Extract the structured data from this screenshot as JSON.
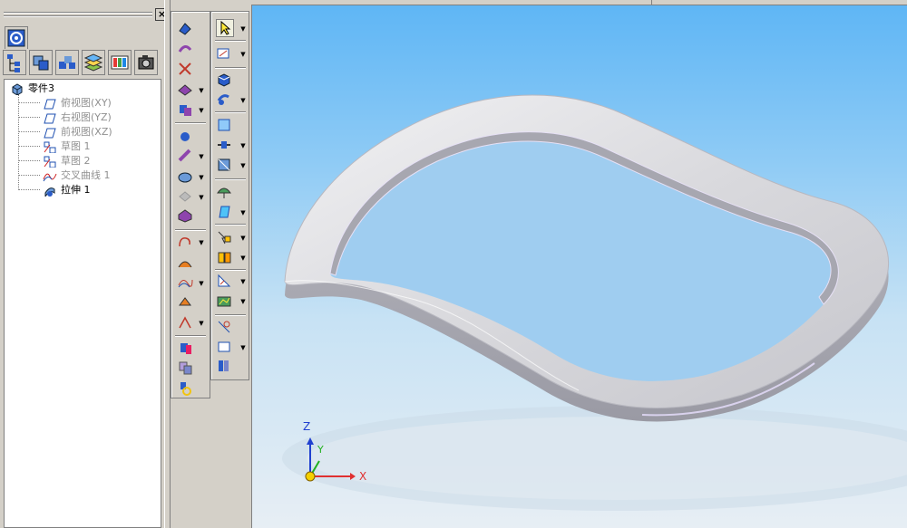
{
  "tree": {
    "root": "零件3",
    "items": [
      {
        "label": "俯视图(XY)",
        "icon": "plane-icon",
        "dim": true
      },
      {
        "label": "右视图(YZ)",
        "icon": "plane-icon",
        "dim": true
      },
      {
        "label": "前视图(XZ)",
        "icon": "plane-icon",
        "dim": true
      },
      {
        "label": "草图 1",
        "icon": "sketch-icon",
        "dim": true
      },
      {
        "label": "草图 2",
        "icon": "sketch-icon",
        "dim": true
      },
      {
        "label": "交叉曲线 1",
        "icon": "curve-icon",
        "dim": true
      },
      {
        "label": "拉伸 1",
        "icon": "extrude-icon",
        "dim": false
      }
    ]
  },
  "axes": {
    "x": "X",
    "y": "Y",
    "z": "Z"
  },
  "colors": {
    "viewport_top": "#5fb6f5",
    "viewport_bottom": "#e7eef4",
    "x_axis": "#e03030",
    "y_axis": "#20b020",
    "z_axis": "#2040d0"
  }
}
